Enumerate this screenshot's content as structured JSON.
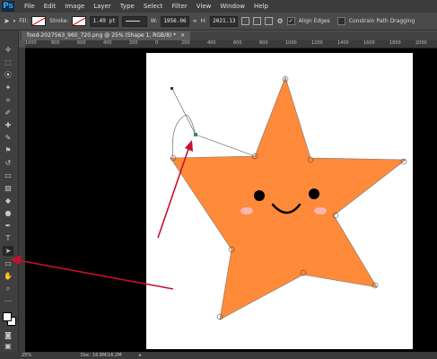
{
  "menubar": {
    "logo": "Ps",
    "items": [
      "File",
      "Edit",
      "Image",
      "Layer",
      "Type",
      "Select",
      "Filter",
      "View",
      "Window",
      "Help"
    ]
  },
  "options": {
    "fill_label": "Fill:",
    "stroke_label": "Stroke:",
    "stroke_width": "1.49 pt",
    "w_label": "W:",
    "w_value": "1956.06",
    "h_label": "H:",
    "h_value": "2021.13",
    "align_edges_label": "Align Edges",
    "constrain_label": "Constrain Path Dragging"
  },
  "document": {
    "tab_title": "food-2027563_960_720.png @ 25% (Shape 1, RGB/8) *"
  },
  "ruler": {
    "h_ticks": [
      "1000",
      "800",
      "600",
      "400",
      "200",
      "0",
      "200",
      "400",
      "600",
      "800",
      "1000",
      "1200",
      "1400",
      "1600",
      "1800",
      "2000"
    ]
  },
  "status": {
    "zoom": "25%",
    "doc_info": "Doc: 16.8M/16.2M"
  },
  "colors": {
    "star_fill": "#FF8A3A",
    "arrow": "#C8102E",
    "cheek": "#F7B7B0",
    "canvas_bg": "#000000"
  }
}
